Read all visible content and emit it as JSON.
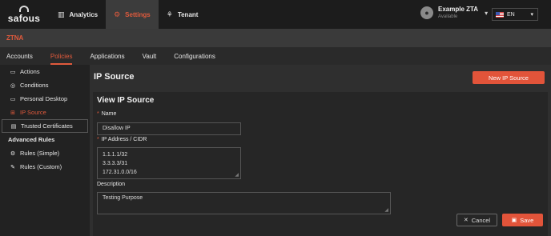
{
  "brand": {
    "logo_text": "safous"
  },
  "topnav": {
    "items": [
      {
        "label": "Analytics",
        "icon": "bar-chart-icon"
      },
      {
        "label": "Settings",
        "icon": "gear-icon"
      },
      {
        "label": "Tenant",
        "icon": "tenant-icon"
      }
    ],
    "active": "Settings"
  },
  "user": {
    "name": "Example ZTA",
    "status": "Available",
    "icon": "user-avatar-icon"
  },
  "language": {
    "selected": "EN",
    "icon": "us-flag-icon"
  },
  "module": {
    "title": "ZTNA"
  },
  "tabs": {
    "items": [
      "Accounts",
      "Policies",
      "Applications",
      "Vault",
      "Configurations"
    ],
    "active": "Policies"
  },
  "sidebar": {
    "items": [
      {
        "label": "Actions",
        "icon": "monitor-icon"
      },
      {
        "label": "Conditions",
        "icon": "check-circle-icon"
      },
      {
        "label": "Personal Desktop",
        "icon": "monitor-icon"
      },
      {
        "label": "IP Source",
        "icon": "network-icon"
      },
      {
        "label": "Trusted Certificates",
        "icon": "certificate-icon"
      }
    ],
    "active": "IP Source",
    "section_header": "Advanced Rules",
    "advanced_items": [
      {
        "label": "Rules (Simple)",
        "icon": "gear-icon"
      },
      {
        "label": "Rules (Custom)",
        "icon": "wrench-icon"
      }
    ]
  },
  "page": {
    "title": "IP Source",
    "new_button": "New IP Source"
  },
  "form": {
    "title": "View IP Source",
    "name_label": "Name",
    "name_value": "Disallow IP",
    "ip_label": "IP Address / CIDR",
    "ip_values": [
      "1.1.1.1/32",
      "3.3.3.3/31",
      "172.31.0.0/16"
    ],
    "description_label": "Description",
    "description_value": "Testing Purpose",
    "cancel_button": "Cancel",
    "save_button": "Save"
  },
  "colors": {
    "accent": "#e2543a",
    "topbar": "#1c1c1c",
    "background": "#2a2a2a"
  }
}
